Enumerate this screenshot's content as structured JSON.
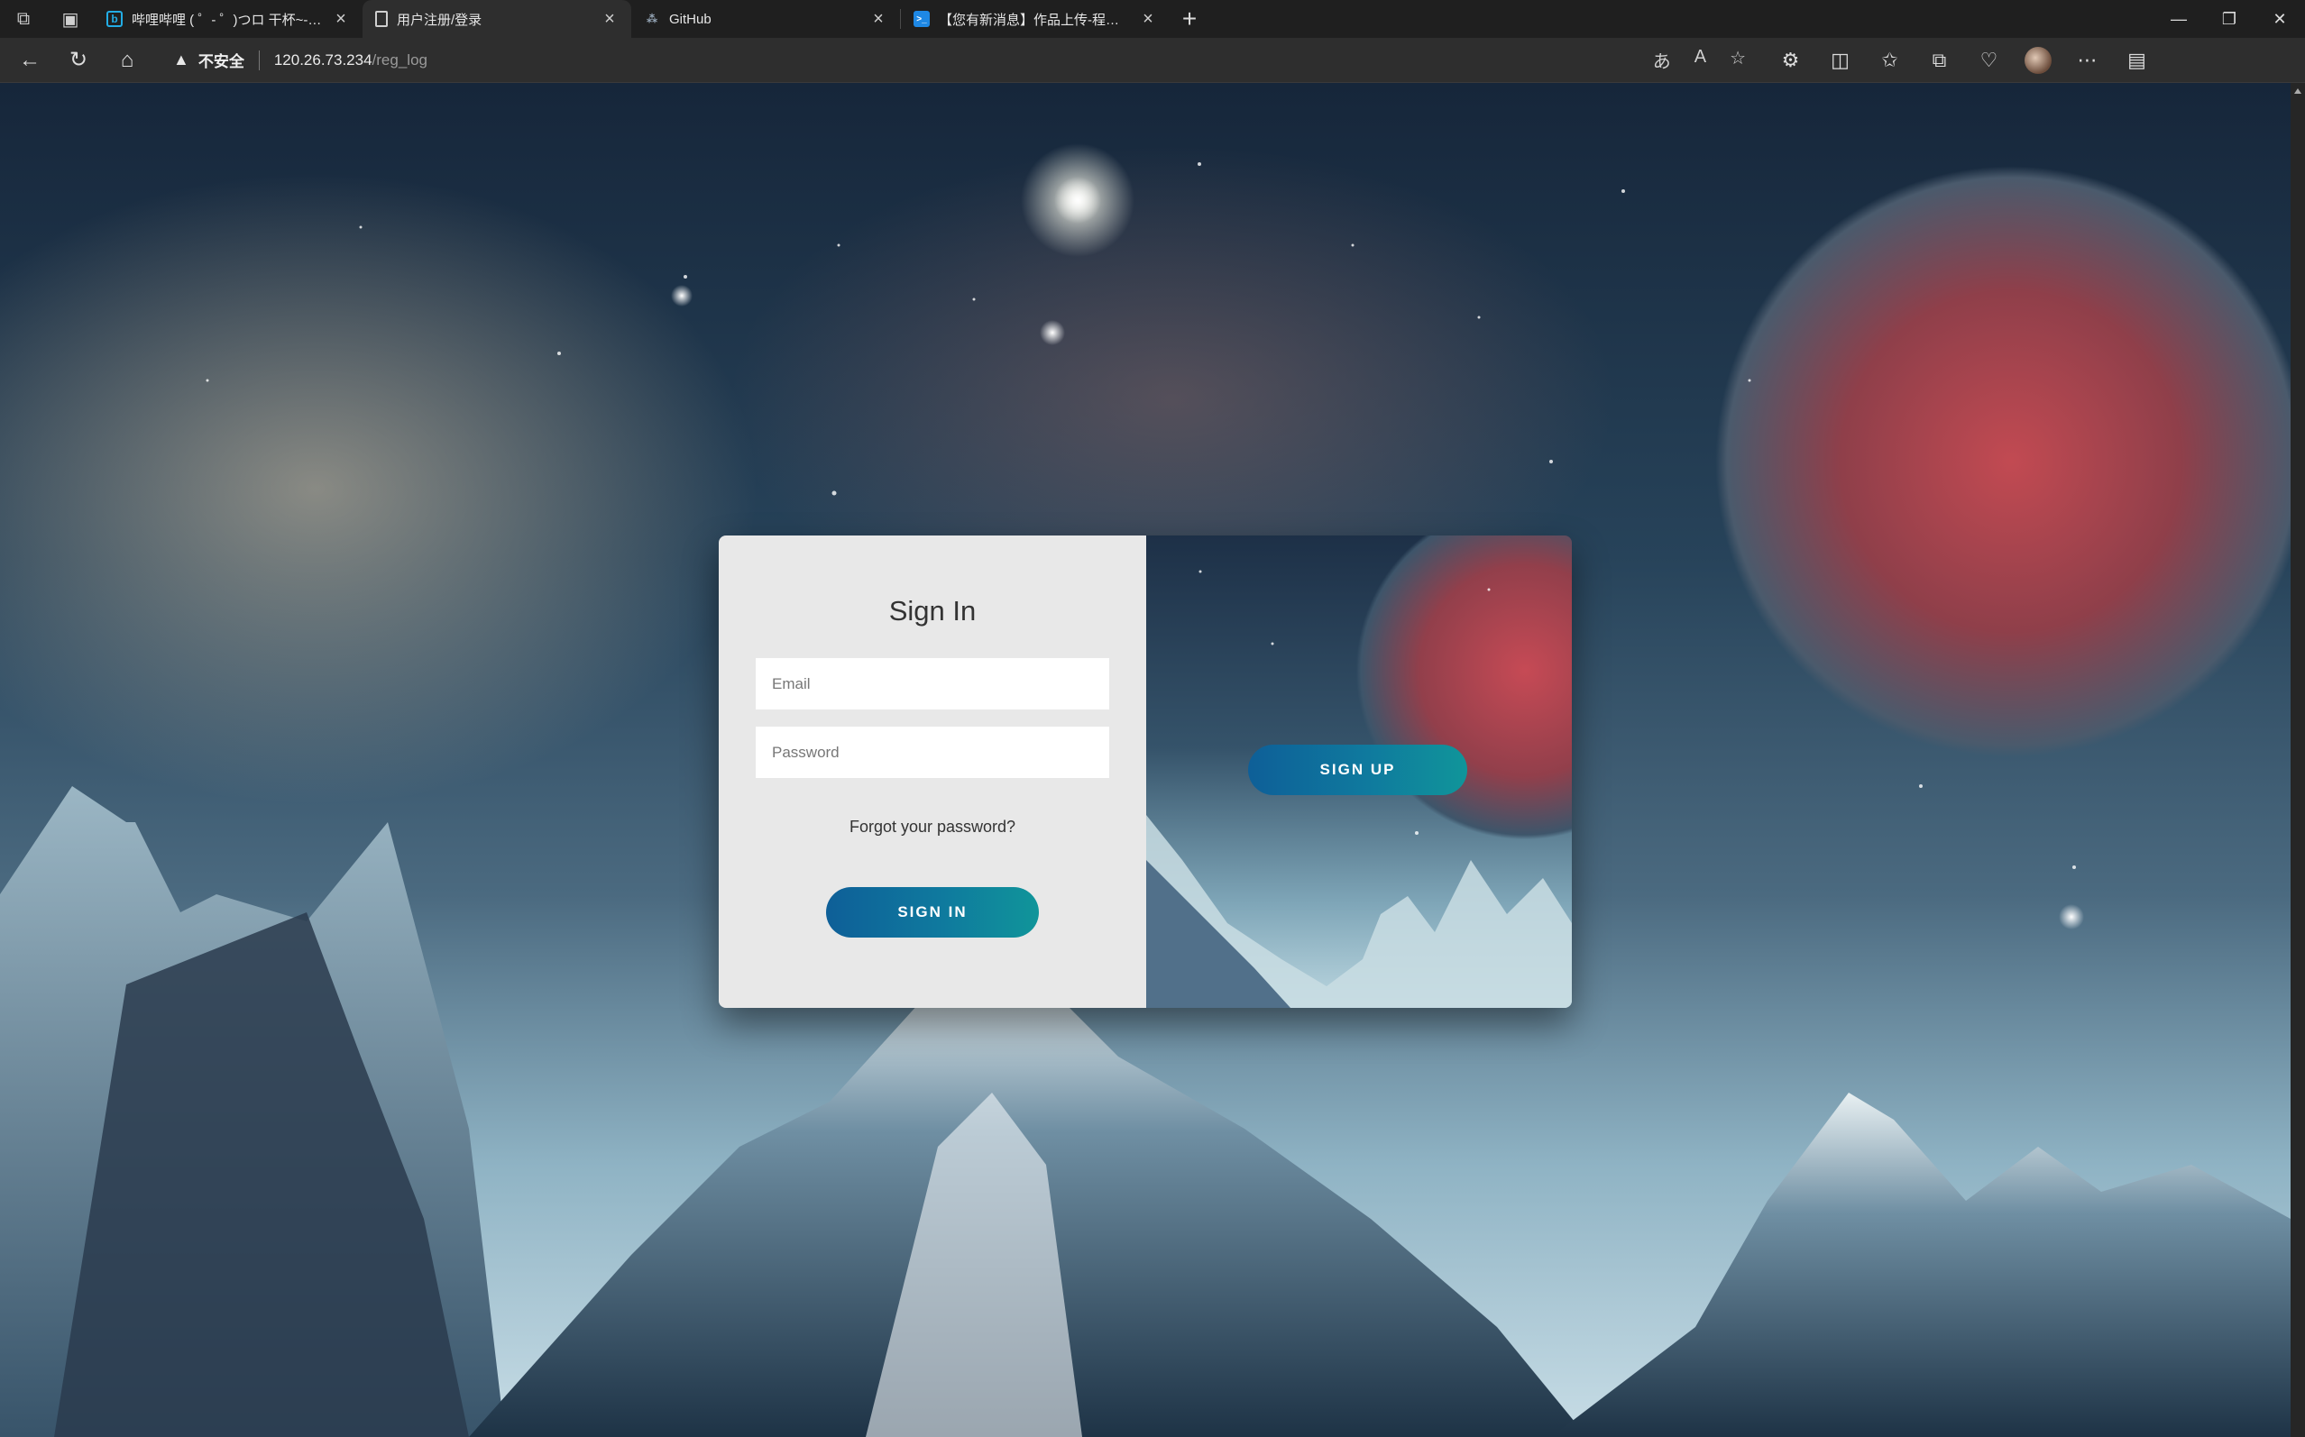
{
  "browser": {
    "tabs": [
      {
        "title": "哔哩哔哩 ( ゜- ゜)つロ 干杯~-bilibili",
        "favicon": "bilibili-icon",
        "active": false
      },
      {
        "title": "用户注册/登录",
        "favicon": "page-icon",
        "active": true
      },
      {
        "title": "GitHub",
        "favicon": "github-icon",
        "active": false
      },
      {
        "title": "【您有新消息】作品上传-程序员",
        "favicon": "terminal-icon",
        "active": false
      }
    ],
    "security_label": "不安全",
    "url_host": "120.26.73.234",
    "url_path": "/reg_log"
  },
  "login": {
    "title": "Sign In",
    "email_placeholder": "Email",
    "password_placeholder": "Password",
    "forgot_label": "Forgot your password?",
    "signin_label": "SIGN IN",
    "signup_label": "SIGN UP"
  },
  "colors": {
    "button_gradient_start": "#0e5f98",
    "button_gradient_end": "#10959a",
    "panel_bg": "#e8e8e8"
  }
}
